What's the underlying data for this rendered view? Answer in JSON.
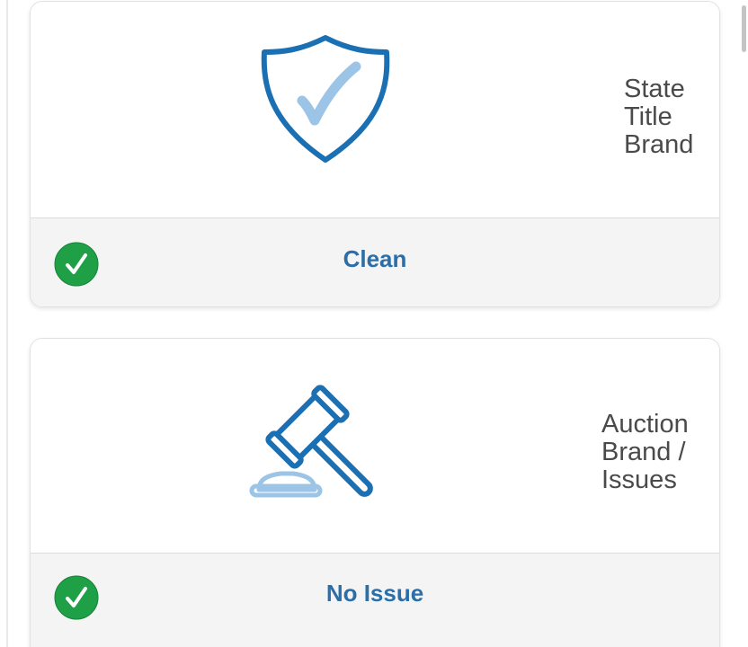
{
  "cards": [
    {
      "label": "State\nTitle\nBrand",
      "icon": "shield-check-icon",
      "status_text": "Clean",
      "status_icon": "check-circle-icon"
    },
    {
      "label": "Auction\nBrand /\nIssues",
      "icon": "gavel-icon",
      "status_text": "No Issue",
      "status_icon": "check-circle-icon"
    }
  ],
  "colors": {
    "icon_blue": "#1b6fb3",
    "icon_light_blue": "#9cc4e6",
    "status_text": "#2b6ea8",
    "status_green": "#1f9f46",
    "label_text": "#4a4a4a"
  }
}
